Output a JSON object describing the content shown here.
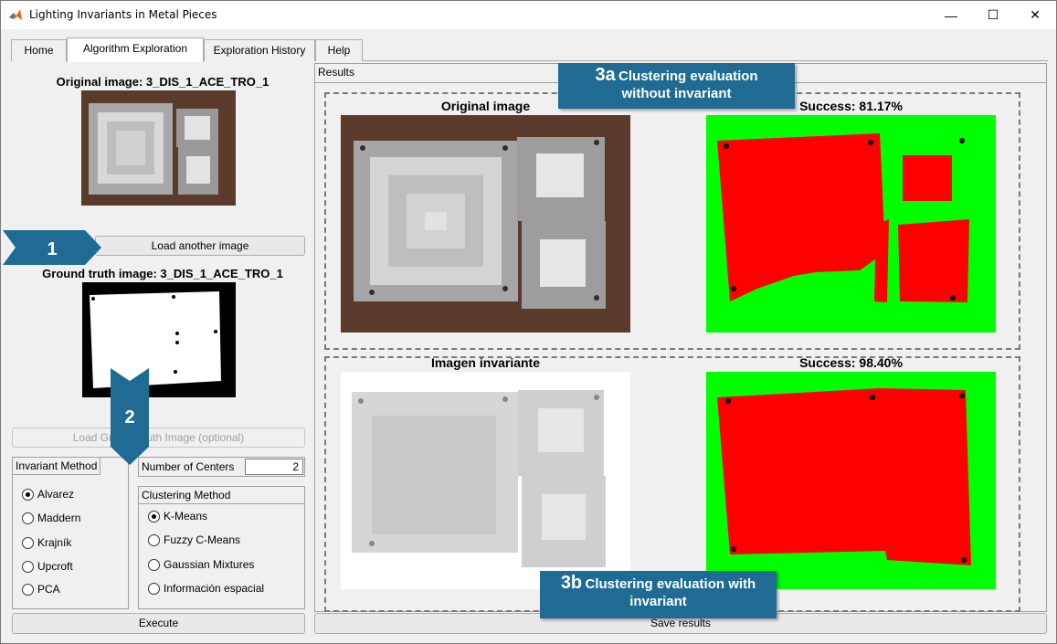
{
  "window": {
    "title": "Lighting Invariants in Metal Pieces"
  },
  "window_buttons": {
    "minimize": "—",
    "maximize": "☐",
    "close": "✕"
  },
  "tabs": [
    {
      "label": "Home"
    },
    {
      "label": "Algorithm Exploration"
    },
    {
      "label": "Exploration History"
    },
    {
      "label": "Help"
    }
  ],
  "left": {
    "original_title": "Original image: 3_DIS_1_ACE_TRO_1",
    "load_another_label": "Load another image",
    "ground_truth_title": "Ground truth image: 3_DIS_1_ACE_TRO_1",
    "load_gt_label": "Load Ground truth Image (optional)",
    "invariant_method": {
      "title": "Invariant Method",
      "options": [
        "Alvarez",
        "Maddern",
        "Krajník",
        "Upcroft",
        "PCA"
      ],
      "selected": "Alvarez"
    },
    "num_centers": {
      "label": "Number of Centers",
      "value": "2"
    },
    "clustering_method": {
      "title": "Clustering Method",
      "options": [
        "K-Means",
        "Fuzzy C-Means",
        "Gaussian Mixtures",
        "Información espacial"
      ],
      "selected": "K-Means"
    },
    "execute_label": "Execute"
  },
  "results": {
    "label": "Results",
    "top": {
      "image_title": "Original image",
      "success_title": "Success: 81.17%"
    },
    "bottom": {
      "image_title": "Imagen invariante",
      "success_title": "Success: 98.40%"
    },
    "save_label": "Save results"
  },
  "callouts": {
    "c1": "1",
    "c2": "2",
    "c3a_num": "3a",
    "c3a_text1": "Clustering evaluation",
    "c3a_text2": "without  invariant",
    "c3b_num": "3b",
    "c3b_text1": "Clustering evaluation with",
    "c3b_text2": "invariant"
  },
  "colors": {
    "callout": "#1f6b93",
    "success_green": "#00ff00",
    "error_red": "#ff0000"
  }
}
